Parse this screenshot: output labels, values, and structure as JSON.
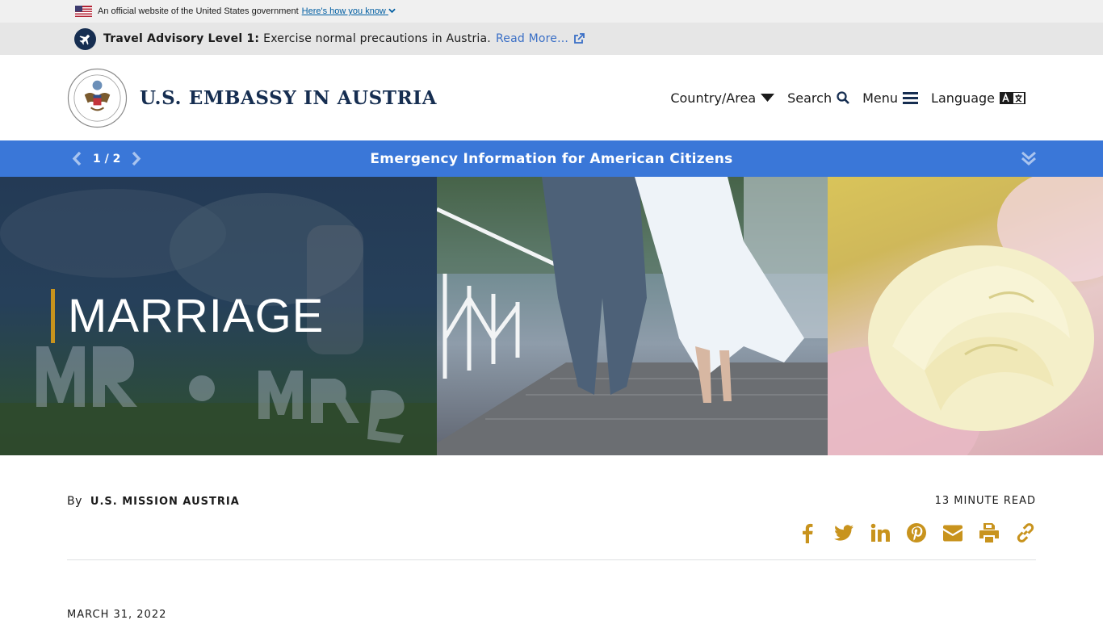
{
  "gov_banner": {
    "text": "An official website of the United States government",
    "link": "Here's how you know"
  },
  "advisory": {
    "title": "Travel Advisory Level 1:",
    "text": "Exercise normal precautions in Austria.",
    "link": "Read More..."
  },
  "header": {
    "site_title": "U.S. EMBASSY IN AUSTRIA",
    "nav": {
      "country": "Country/Area",
      "search": "Search",
      "menu": "Menu",
      "language": "Language"
    }
  },
  "alert": {
    "pager": "1 / 2",
    "title": "Emergency Information for American Citizens"
  },
  "hero": {
    "title": "MARRIAGE"
  },
  "article": {
    "by_label": "By",
    "author": "U.S. MISSION AUSTRIA",
    "read_time": "13 MINUTE READ",
    "date": "MARCH 31, 2022"
  },
  "colors": {
    "navy": "#162e51",
    "alert_blue": "#3a77d8",
    "accent_gold": "#c8931d",
    "link_blue": "#005ea2"
  },
  "icons": [
    "us-flag-icon",
    "plane-icon",
    "external-link-icon",
    "caret-down-icon",
    "search-icon",
    "hamburger-icon",
    "language-icon",
    "chevron-left-icon",
    "chevron-right-icon",
    "double-chevron-down-icon",
    "facebook-icon",
    "twitter-icon",
    "linkedin-icon",
    "pinterest-icon",
    "email-icon",
    "print-icon",
    "link-icon"
  ]
}
